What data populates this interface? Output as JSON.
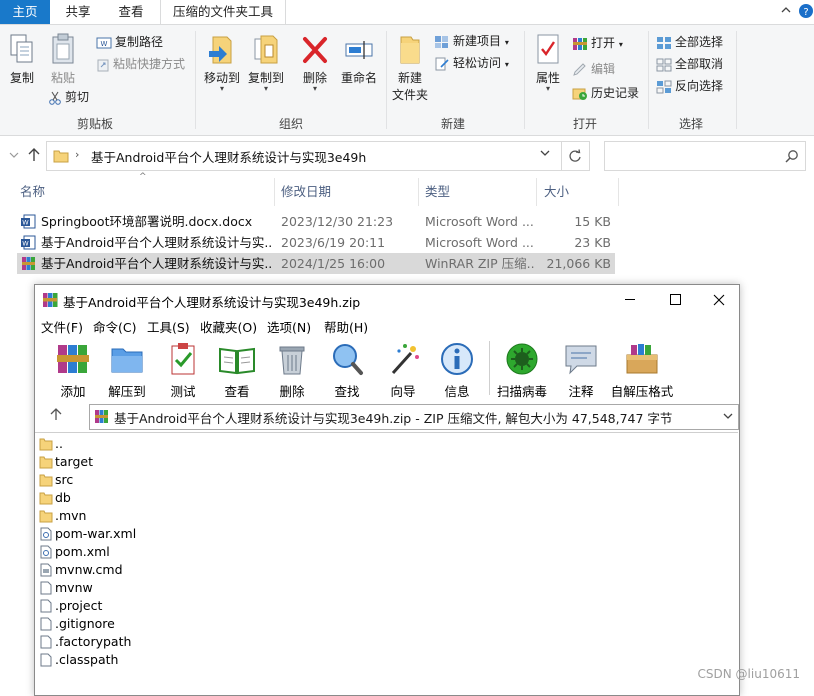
{
  "explorer": {
    "tabs": [
      "主页",
      "共享",
      "查看",
      "压缩的文件夹工具"
    ],
    "ribbon": {
      "clipboard": {
        "group_label": "剪贴板",
        "copy": "复制",
        "paste": "粘贴",
        "copy_path": "复制路径",
        "paste_shortcut": "粘贴快捷方式",
        "cut": "剪切"
      },
      "organize": {
        "group_label": "组织",
        "move_to": "移动到",
        "copy_to": "复制到",
        "delete": "删除",
        "rename": "重命名"
      },
      "new": {
        "group_label": "新建",
        "new_folder_l1": "新建",
        "new_folder_l2": "文件夹",
        "new_item": "新建项目",
        "easy_access": "轻松访问"
      },
      "open": {
        "group_label": "打开",
        "properties": "属性",
        "open": "打开",
        "edit": "编辑",
        "history": "历史记录"
      },
      "select": {
        "group_label": "选择",
        "select_all": "全部选择",
        "select_none": "全部取消",
        "invert": "反向选择"
      }
    },
    "address": {
      "path": "基于Android平台个人理财系统设计与实现3e49h",
      "search_placeholder": ""
    },
    "columns": {
      "name": "名称",
      "date": "修改日期",
      "type": "类型",
      "size": "大小"
    },
    "files": [
      {
        "name": "Springboot环境部署说明.docx.docx",
        "date": "2023/12/30 21:23",
        "type": "Microsoft Word ...",
        "size": "15 KB",
        "icon": "word-doc-icon"
      },
      {
        "name": "基于Android平台个人理财系统设计与实...",
        "date": "2023/6/19 20:11",
        "type": "Microsoft Word ...",
        "size": "23 KB",
        "icon": "word-doc-icon"
      },
      {
        "name": "基于Android平台个人理财系统设计与实...",
        "date": "2024/1/25 16:00",
        "type": "WinRAR ZIP 压缩...",
        "size": "21,066 KB",
        "icon": "winrar-icon"
      }
    ]
  },
  "winrar": {
    "title": "基于Android平台个人理财系统设计与实现3e49h.zip",
    "menu": [
      "文件(F)",
      "命令(C)",
      "工具(S)",
      "收藏夹(O)",
      "选项(N)",
      "帮助(H)"
    ],
    "toolbar": [
      "添加",
      "解压到",
      "测试",
      "查看",
      "删除",
      "查找",
      "向导",
      "信息",
      "扫描病毒",
      "注释",
      "自解压格式"
    ],
    "path_text": "基于Android平台个人理财系统设计与实现3e49h.zip - ZIP 压缩文件, 解包大小为 47,548,747 字节",
    "items": [
      {
        "name": "..",
        "kind": "folder"
      },
      {
        "name": "target",
        "kind": "folder"
      },
      {
        "name": "src",
        "kind": "folder"
      },
      {
        "name": "db",
        "kind": "folder"
      },
      {
        "name": ".mvn",
        "kind": "folder"
      },
      {
        "name": "pom-war.xml",
        "kind": "xml"
      },
      {
        "name": "pom.xml",
        "kind": "xml"
      },
      {
        "name": "mvnw.cmd",
        "kind": "cmd"
      },
      {
        "name": "mvnw",
        "kind": "file"
      },
      {
        "name": ".project",
        "kind": "file"
      },
      {
        "name": ".gitignore",
        "kind": "file"
      },
      {
        "name": ".factorypath",
        "kind": "file"
      },
      {
        "name": ".classpath",
        "kind": "file"
      }
    ]
  },
  "watermark": "CSDN @liu10611"
}
